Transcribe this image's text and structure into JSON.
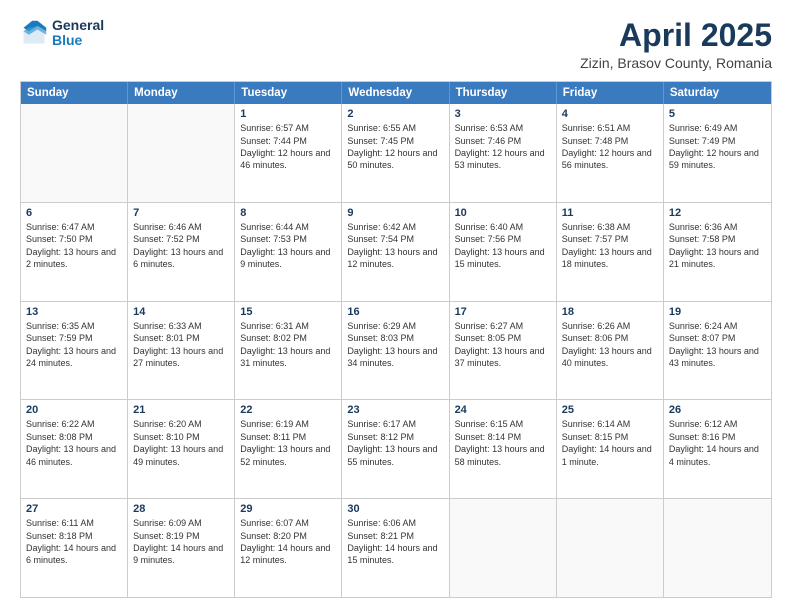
{
  "header": {
    "logo_general": "General",
    "logo_blue": "Blue",
    "title": "April 2025",
    "location": "Zizin, Brasov County, Romania"
  },
  "days_of_week": [
    "Sunday",
    "Monday",
    "Tuesday",
    "Wednesday",
    "Thursday",
    "Friday",
    "Saturday"
  ],
  "weeks": [
    [
      {
        "day": "",
        "text": "",
        "empty": true
      },
      {
        "day": "",
        "text": "",
        "empty": true
      },
      {
        "day": "1",
        "text": "Sunrise: 6:57 AM\nSunset: 7:44 PM\nDaylight: 12 hours and 46 minutes."
      },
      {
        "day": "2",
        "text": "Sunrise: 6:55 AM\nSunset: 7:45 PM\nDaylight: 12 hours and 50 minutes."
      },
      {
        "day": "3",
        "text": "Sunrise: 6:53 AM\nSunset: 7:46 PM\nDaylight: 12 hours and 53 minutes."
      },
      {
        "day": "4",
        "text": "Sunrise: 6:51 AM\nSunset: 7:48 PM\nDaylight: 12 hours and 56 minutes."
      },
      {
        "day": "5",
        "text": "Sunrise: 6:49 AM\nSunset: 7:49 PM\nDaylight: 12 hours and 59 minutes."
      }
    ],
    [
      {
        "day": "6",
        "text": "Sunrise: 6:47 AM\nSunset: 7:50 PM\nDaylight: 13 hours and 2 minutes."
      },
      {
        "day": "7",
        "text": "Sunrise: 6:46 AM\nSunset: 7:52 PM\nDaylight: 13 hours and 6 minutes."
      },
      {
        "day": "8",
        "text": "Sunrise: 6:44 AM\nSunset: 7:53 PM\nDaylight: 13 hours and 9 minutes."
      },
      {
        "day": "9",
        "text": "Sunrise: 6:42 AM\nSunset: 7:54 PM\nDaylight: 13 hours and 12 minutes."
      },
      {
        "day": "10",
        "text": "Sunrise: 6:40 AM\nSunset: 7:56 PM\nDaylight: 13 hours and 15 minutes."
      },
      {
        "day": "11",
        "text": "Sunrise: 6:38 AM\nSunset: 7:57 PM\nDaylight: 13 hours and 18 minutes."
      },
      {
        "day": "12",
        "text": "Sunrise: 6:36 AM\nSunset: 7:58 PM\nDaylight: 13 hours and 21 minutes."
      }
    ],
    [
      {
        "day": "13",
        "text": "Sunrise: 6:35 AM\nSunset: 7:59 PM\nDaylight: 13 hours and 24 minutes."
      },
      {
        "day": "14",
        "text": "Sunrise: 6:33 AM\nSunset: 8:01 PM\nDaylight: 13 hours and 27 minutes."
      },
      {
        "day": "15",
        "text": "Sunrise: 6:31 AM\nSunset: 8:02 PM\nDaylight: 13 hours and 31 minutes."
      },
      {
        "day": "16",
        "text": "Sunrise: 6:29 AM\nSunset: 8:03 PM\nDaylight: 13 hours and 34 minutes."
      },
      {
        "day": "17",
        "text": "Sunrise: 6:27 AM\nSunset: 8:05 PM\nDaylight: 13 hours and 37 minutes."
      },
      {
        "day": "18",
        "text": "Sunrise: 6:26 AM\nSunset: 8:06 PM\nDaylight: 13 hours and 40 minutes."
      },
      {
        "day": "19",
        "text": "Sunrise: 6:24 AM\nSunset: 8:07 PM\nDaylight: 13 hours and 43 minutes."
      }
    ],
    [
      {
        "day": "20",
        "text": "Sunrise: 6:22 AM\nSunset: 8:08 PM\nDaylight: 13 hours and 46 minutes."
      },
      {
        "day": "21",
        "text": "Sunrise: 6:20 AM\nSunset: 8:10 PM\nDaylight: 13 hours and 49 minutes."
      },
      {
        "day": "22",
        "text": "Sunrise: 6:19 AM\nSunset: 8:11 PM\nDaylight: 13 hours and 52 minutes."
      },
      {
        "day": "23",
        "text": "Sunrise: 6:17 AM\nSunset: 8:12 PM\nDaylight: 13 hours and 55 minutes."
      },
      {
        "day": "24",
        "text": "Sunrise: 6:15 AM\nSunset: 8:14 PM\nDaylight: 13 hours and 58 minutes."
      },
      {
        "day": "25",
        "text": "Sunrise: 6:14 AM\nSunset: 8:15 PM\nDaylight: 14 hours and 1 minute."
      },
      {
        "day": "26",
        "text": "Sunrise: 6:12 AM\nSunset: 8:16 PM\nDaylight: 14 hours and 4 minutes."
      }
    ],
    [
      {
        "day": "27",
        "text": "Sunrise: 6:11 AM\nSunset: 8:18 PM\nDaylight: 14 hours and 6 minutes."
      },
      {
        "day": "28",
        "text": "Sunrise: 6:09 AM\nSunset: 8:19 PM\nDaylight: 14 hours and 9 minutes."
      },
      {
        "day": "29",
        "text": "Sunrise: 6:07 AM\nSunset: 8:20 PM\nDaylight: 14 hours and 12 minutes."
      },
      {
        "day": "30",
        "text": "Sunrise: 6:06 AM\nSunset: 8:21 PM\nDaylight: 14 hours and 15 minutes."
      },
      {
        "day": "",
        "text": "",
        "empty": true
      },
      {
        "day": "",
        "text": "",
        "empty": true
      },
      {
        "day": "",
        "text": "",
        "empty": true
      }
    ]
  ]
}
